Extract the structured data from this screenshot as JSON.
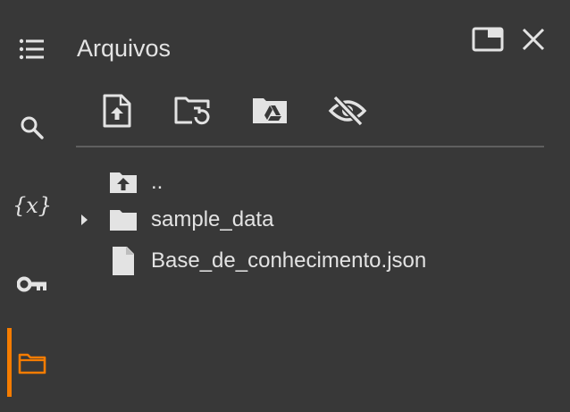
{
  "colors": {
    "background": "#383838",
    "accent": "#f57c00",
    "icon": "#e3e3e3",
    "divider": "#5f5f5f"
  },
  "sidebar": {
    "items": [
      {
        "icon": "table-of-contents-icon",
        "active": false
      },
      {
        "icon": "search-icon",
        "active": false
      },
      {
        "icon": "variables-icon",
        "label": "{x}",
        "active": false
      },
      {
        "icon": "key-icon",
        "active": false
      },
      {
        "icon": "folder-icon",
        "active": true
      }
    ]
  },
  "panel": {
    "title": "Arquivos",
    "header_icons": [
      "open-in-tab-icon",
      "close-icon"
    ],
    "toolbar_icons": [
      "upload-file-icon",
      "refresh-folder-icon",
      "mount-drive-icon",
      "hide-hidden-files-icon"
    ]
  },
  "tree": {
    "items": [
      {
        "label": "..",
        "icon": "parent-folder-icon",
        "expandable": false
      },
      {
        "label": "sample_data",
        "icon": "folder-icon",
        "expandable": true
      },
      {
        "label": "Base_de_conhecimento.json",
        "icon": "file-icon",
        "expandable": false
      }
    ]
  }
}
